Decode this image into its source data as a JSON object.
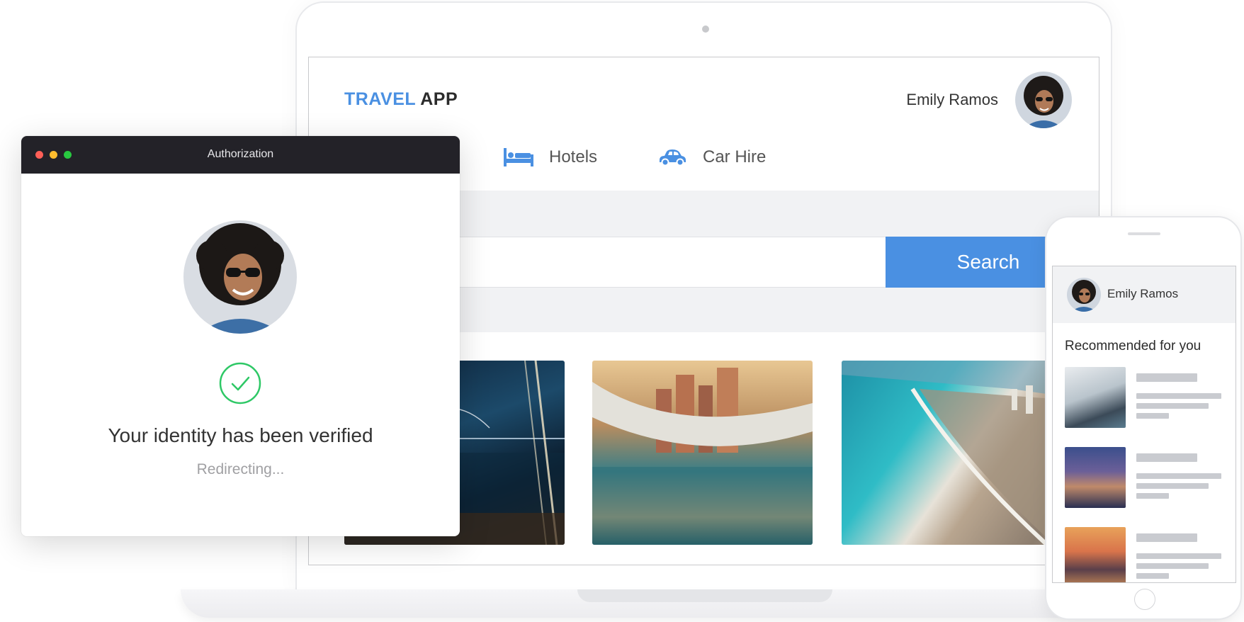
{
  "laptop_app": {
    "brand_part1": "TRAVEL",
    "brand_part2": "APP",
    "user_name": "Emily Ramos",
    "nav": [
      {
        "label": "Hotels",
        "icon": "bed-icon"
      },
      {
        "label": "Car Hire",
        "icon": "car-icon"
      }
    ],
    "search_button": "Search",
    "accent_color": "#4a90e2"
  },
  "auth_window": {
    "title": "Authorization",
    "status": "Your identity has been verified",
    "subtext": "Redirecting...",
    "check_color": "#2ec866"
  },
  "phone_app": {
    "user_name": "Emily Ramos",
    "section_title": "Recommended for you"
  }
}
